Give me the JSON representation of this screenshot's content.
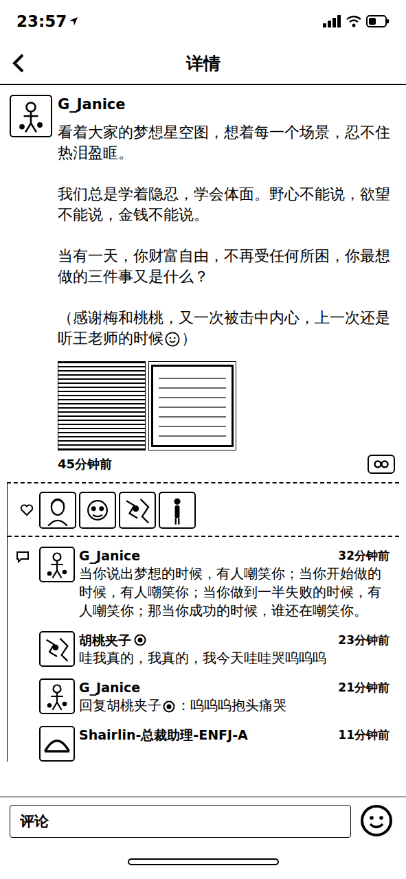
{
  "status_bar": {
    "time": "23:57"
  },
  "header": {
    "title": "详情"
  },
  "post": {
    "author": "G_Janice",
    "paragraphs": [
      "看着大家的梦想星空图，想着每一个场景，忍不住热泪盈眶。",
      "我们总是学着隐忍，学会体面。野心不能说，欲望不能说，金钱不能说。",
      "当有一天，你财富自由，不再受任何所困，你最想做的三件事又是什么？"
    ],
    "closing": {
      "before_emoji": "（感谢梅和桃桃，又一次被击中内心，上一次还是听王老师的时候",
      "after_emoji": "）"
    },
    "images": [
      {
        "kind": "table"
      },
      {
        "kind": "document"
      }
    ],
    "time": "45分钟前"
  },
  "likes": [
    {
      "kind": "portrait"
    },
    {
      "kind": "cartoon"
    },
    {
      "kind": "sketch"
    },
    {
      "kind": "figure"
    }
  ],
  "comments": [
    {
      "author": "G_Janice",
      "verified": false,
      "time": "32分钟前",
      "reply_prefix": "",
      "reply_to": "",
      "reply_to_verified": false,
      "text": "当你说出梦想的时候，有人嘲笑你；当你开始做的时候，有人嘲笑你；当你做到一半失败的时候，有人嘲笑你；那当你成功的时候，谁还在嘲笑你。"
    },
    {
      "author": "胡桃夹子",
      "verified": true,
      "time": "23分钟前",
      "reply_prefix": "",
      "reply_to": "",
      "reply_to_verified": false,
      "text": "哇我真的，我真的，我今天哇哇哭呜呜呜"
    },
    {
      "author": "G_Janice",
      "verified": false,
      "time": "21分钟前",
      "reply_prefix": "回复",
      "reply_to": "胡桃夹子",
      "reply_to_verified": true,
      "text": "：呜呜呜抱头痛哭"
    },
    {
      "author": "Shairlin-总裁助理-ENFJ-A",
      "verified": false,
      "time": "11分钟前",
      "reply_prefix": "",
      "reply_to": "",
      "reply_to_verified": false,
      "text": ""
    }
  ],
  "composer": {
    "placeholder": "评论"
  }
}
